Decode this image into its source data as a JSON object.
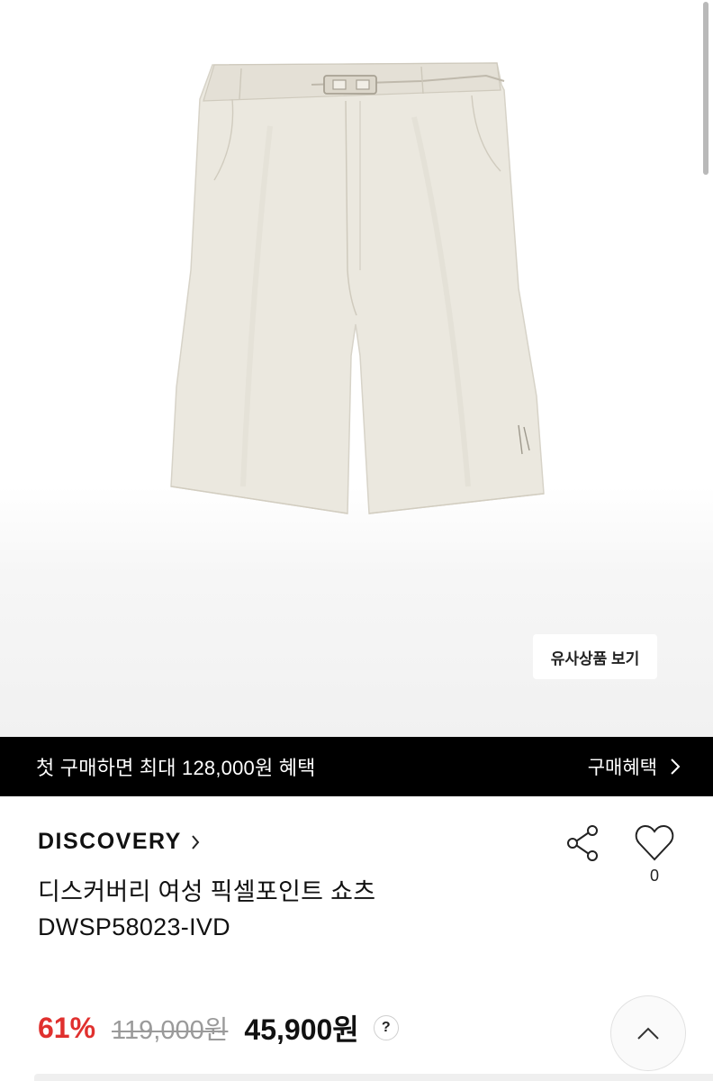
{
  "colors": {
    "promo_bg": "#000000",
    "discount": "#e0302e",
    "product": "#ebe8df"
  },
  "product_image": {
    "subject": "ivory-belted-shorts"
  },
  "similar_button": {
    "label": "유사상품 보기"
  },
  "promo": {
    "text": "첫 구매하면 최대 128,000원 혜택",
    "link_label": "구매혜택",
    "link_icon": "chevron-right-icon"
  },
  "product": {
    "brand": "DISCOVERY",
    "brand_icon": "chevron-right-icon",
    "name": "디스커버리 여성 픽셀포인트 쇼츠",
    "code": "DWSP58023-IVD",
    "like_count": "0",
    "share_icon": "share-icon",
    "like_icon": "heart-outline-icon"
  },
  "price": {
    "discount": "61%",
    "original": "119,000원",
    "sale": "45,900원",
    "help": "?"
  },
  "scroll_top": {
    "icon": "chevron-up-icon"
  }
}
